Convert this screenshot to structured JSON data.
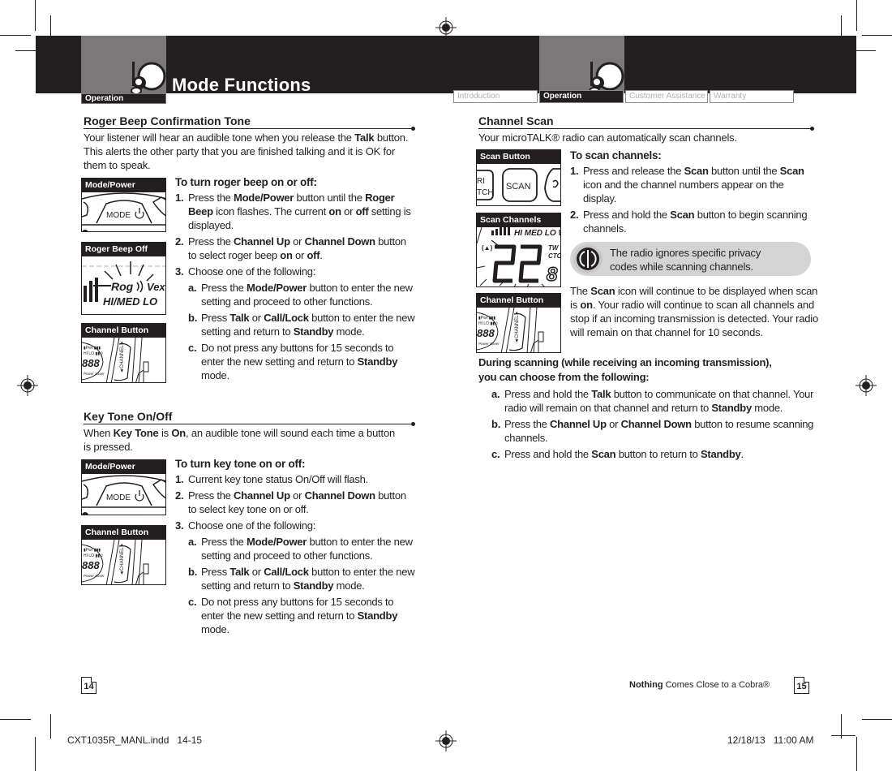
{
  "header": {
    "section_label": "Operation",
    "page_title": "Mode Functions",
    "tabs": [
      {
        "label": "Introduction",
        "active": false
      },
      {
        "label": "Operation",
        "active": true
      },
      {
        "label": "Customer Assistance",
        "active": false
      },
      {
        "label": "Warranty",
        "active": false
      }
    ],
    "colors": {
      "band": "#231f20",
      "tab_box": "#7a7878",
      "note_bg": "#d4d4d4"
    }
  },
  "left_page": {
    "roger_beep": {
      "heading": "Roger Beep Confirmation Tone",
      "intro_pre": "Your listener will hear an audible tone when you release the ",
      "intro_bold": "Talk",
      "intro_post": " button. This alerts the other party that you are finished talking and it is OK for them to speak.",
      "figures": [
        {
          "caption": "Mode/Power",
          "icon": "mode-power-button"
        },
        {
          "caption": "Roger Beep Off",
          "icon": "roger-beep-display"
        },
        {
          "caption": "Channel Button",
          "icon": "channel-button"
        }
      ],
      "procedure_title": "To turn roger beep on or off:",
      "steps": [
        {
          "n": "1.",
          "parts": [
            [
              "Press the ",
              false
            ],
            [
              "Mode/Power",
              true
            ],
            [
              " button until the ",
              false
            ],
            [
              "Roger Beep",
              true
            ],
            [
              " icon flashes. The current ",
              false
            ],
            [
              "on",
              true
            ],
            [
              " or ",
              false
            ],
            [
              "off",
              true
            ],
            [
              " setting is displayed.",
              false
            ]
          ]
        },
        {
          "n": "2.",
          "parts": [
            [
              "Press the ",
              false
            ],
            [
              "Channel Up",
              true
            ],
            [
              " or ",
              false
            ],
            [
              "Channel Down",
              true
            ],
            [
              " button to select roger beep ",
              false
            ],
            [
              "on",
              true
            ],
            [
              " or ",
              false
            ],
            [
              "off",
              true
            ],
            [
              ".",
              false
            ]
          ]
        },
        {
          "n": "3.",
          "parts": [
            [
              "Choose one of the following:",
              false
            ]
          ]
        }
      ],
      "substeps": [
        {
          "n": "a.",
          "parts": [
            [
              "Press the ",
              false
            ],
            [
              "Mode/Power",
              true
            ],
            [
              " button to enter the new setting and proceed to other functions.",
              false
            ]
          ]
        },
        {
          "n": "b.",
          "parts": [
            [
              "Press ",
              false
            ],
            [
              "Talk",
              true
            ],
            [
              " or ",
              false
            ],
            [
              "Call/Lock",
              true
            ],
            [
              " button to enter the new setting and return to ",
              false
            ],
            [
              "Standby",
              true
            ],
            [
              " mode.",
              false
            ]
          ]
        },
        {
          "n": "c.",
          "parts": [
            [
              "Do not press any buttons for 15 seconds to enter the new setting and return to ",
              false
            ],
            [
              "Standby",
              true
            ],
            [
              " mode.",
              false
            ]
          ]
        }
      ]
    },
    "key_tone": {
      "heading": "Key Tone On/Off",
      "intro_parts": [
        [
          "When ",
          false
        ],
        [
          "Key Tone",
          true
        ],
        [
          " is ",
          false
        ],
        [
          "On",
          true
        ],
        [
          ", an audible tone will sound each time a button is pressed.",
          false
        ]
      ],
      "figures": [
        {
          "caption": "Mode/Power",
          "icon": "mode-power-button"
        },
        {
          "caption": "Channel Button",
          "icon": "channel-button"
        }
      ],
      "procedure_title": "To turn key tone on or off:",
      "steps": [
        {
          "n": "1.",
          "parts": [
            [
              "Current key tone status On/Off will flash.",
              false
            ]
          ]
        },
        {
          "n": "2.",
          "parts": [
            [
              "Press the ",
              false
            ],
            [
              "Channel Up",
              true
            ],
            [
              " or ",
              false
            ],
            [
              "Channel Down",
              true
            ],
            [
              " button to select key tone on or off.",
              false
            ]
          ]
        },
        {
          "n": "3.",
          "parts": [
            [
              "Choose one of the following:",
              false
            ]
          ]
        }
      ],
      "substeps": [
        {
          "n": "a.",
          "parts": [
            [
              "Press the ",
              false
            ],
            [
              "Mode/Power",
              true
            ],
            [
              " button to enter the new setting and proceed to other functions.",
              false
            ]
          ]
        },
        {
          "n": "b.",
          "parts": [
            [
              "Press ",
              false
            ],
            [
              "Talk",
              true
            ],
            [
              " or ",
              false
            ],
            [
              "Call/Lock",
              true
            ],
            [
              " button to enter the new setting and return to ",
              false
            ],
            [
              "Standby",
              true
            ],
            [
              " mode.",
              false
            ]
          ]
        },
        {
          "n": "c.",
          "parts": [
            [
              "Do not press any buttons for 15 seconds to enter the new setting and return to ",
              false
            ],
            [
              "Standby",
              true
            ],
            [
              " mode.",
              false
            ]
          ]
        }
      ]
    },
    "page_number": "14"
  },
  "right_page": {
    "channel_scan": {
      "heading": "Channel Scan",
      "intro": "Your microTALK® radio can automatically scan channels.",
      "figures": [
        {
          "caption": "Scan Button",
          "icon": "scan-button",
          "button_text": "SCAN",
          "side_text": "RI\nTCH"
        },
        {
          "caption": "Scan Channels",
          "icon": "scan-channels-display",
          "display_text": "22",
          "seg_labels": "HI MED LO"
        },
        {
          "caption": "Channel Button",
          "icon": "channel-button"
        }
      ],
      "procedure_title": "To scan channels:",
      "steps": [
        {
          "n": "1.",
          "parts": [
            [
              "Press and release the ",
              false
            ],
            [
              "Scan",
              true
            ],
            [
              " button until the ",
              false
            ],
            [
              "Scan",
              true
            ],
            [
              " icon and the channel numbers appear on the display.",
              false
            ]
          ]
        },
        {
          "n": "2.",
          "parts": [
            [
              "Press and hold the ",
              false
            ],
            [
              "Scan",
              true
            ],
            [
              " button to begin scanning channels.",
              false
            ]
          ]
        }
      ],
      "note": "The radio ignores specific privacy codes while scanning channels.",
      "continue_parts": [
        [
          "The ",
          false
        ],
        [
          "Scan",
          true
        ],
        [
          " icon will continue to be displayed when scan is ",
          false
        ],
        [
          "on",
          true
        ],
        [
          ". Your radio will continue to scan all channels and stop if an incoming transmission is detected. Your radio will remain on that channel for 10 seconds.",
          false
        ]
      ],
      "during_title": "During scanning (while receiving an incoming transmission), you can choose from the following:",
      "substeps": [
        {
          "n": "a.",
          "parts": [
            [
              "Press and hold the ",
              false
            ],
            [
              "Talk",
              true
            ],
            [
              " button to communicate on that channel. Your radio will remain on that channel and return to ",
              false
            ],
            [
              "Standby",
              true
            ],
            [
              " mode.",
              false
            ]
          ]
        },
        {
          "n": "b.",
          "parts": [
            [
              "Press the ",
              false
            ],
            [
              "Channel Up",
              true
            ],
            [
              " or ",
              false
            ],
            [
              "Channel Down",
              true
            ],
            [
              " button to resume scanning channels.",
              false
            ]
          ]
        },
        {
          "n": "c.",
          "parts": [
            [
              "Press and hold the ",
              false
            ],
            [
              "Scan",
              true
            ],
            [
              " button to return to ",
              false
            ],
            [
              "Standby",
              true
            ],
            [
              ".",
              false
            ]
          ]
        }
      ]
    },
    "tagline_bold": "Nothing",
    "tagline_rest": " Comes Close to a Cobra®",
    "page_number": "15"
  },
  "slug": {
    "file": "CXT1035R_MANL.indd   14-15",
    "timestamp": "12/18/13   11:00 AM"
  }
}
